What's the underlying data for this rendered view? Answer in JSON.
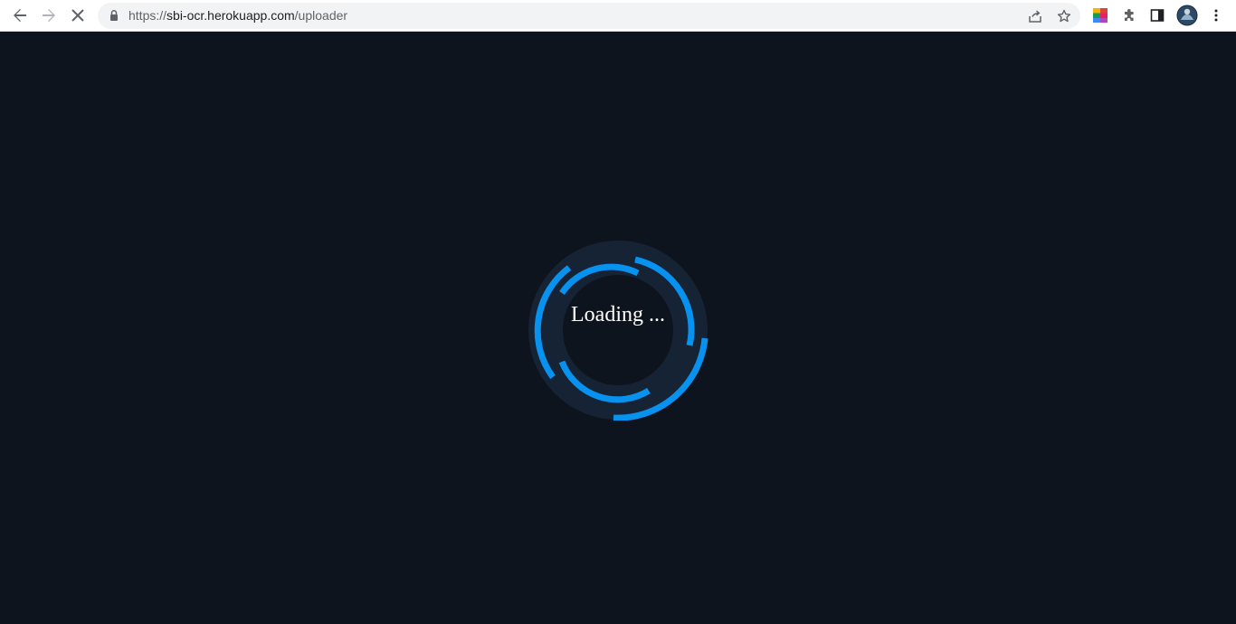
{
  "browser": {
    "url_scheme": "https://",
    "url_host": "sbi-ocr.herokuapp.com",
    "url_path": "/uploader",
    "icons": {
      "back": "back-arrow-icon",
      "forward": "forward-arrow-icon",
      "stop": "stop-loading-icon",
      "lock": "lock-icon",
      "share": "share-icon",
      "star": "star-icon",
      "color_ext": "color-palette-extension-icon",
      "extensions": "puzzle-piece-icon",
      "side_panel": "side-panel-icon",
      "profile": "profile-avatar",
      "menu": "kebab-menu-icon"
    }
  },
  "loader": {
    "text": "Loading ...",
    "ring_color": "#0892ef",
    "track_color": "#152334",
    "background": "#0d141e"
  }
}
